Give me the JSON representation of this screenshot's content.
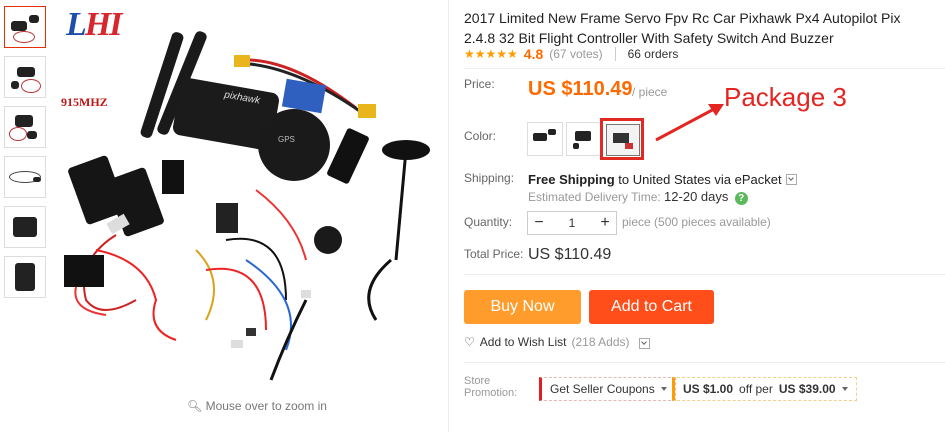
{
  "gallery": {
    "logo_part1": "L",
    "logo_part2": "HI",
    "freq_label": "915MHZ",
    "zoom_hint": "Mouse over to zoom in"
  },
  "product": {
    "title": "2017 Limited New Frame Servo Fpv Rc Car Pixhawk Px4 Autopilot Pix 2.4.8 32 Bit Flight Controller With Safety Switch And Buzzer",
    "rating_stars": "★★★★★",
    "rating_value": "4.8",
    "votes": "(67 votes)",
    "orders": "66 orders"
  },
  "price": {
    "label": "Price:",
    "value": "US $110.49",
    "unit": "/ piece"
  },
  "annotation": {
    "text": "Package 3",
    "color": "#e42521"
  },
  "color": {
    "label": "Color:"
  },
  "shipping": {
    "label": "Shipping:",
    "free_text": "Free Shipping",
    "method_text": "to United States via ePacket",
    "delivery_label": "Estimated Delivery Time:",
    "delivery_days": "12-20 days",
    "help_icon": "?"
  },
  "quantity": {
    "label": "Quantity:",
    "minus": "−",
    "value": "1",
    "plus": "+",
    "info": "piece (500 pieces available)"
  },
  "total": {
    "label": "Total Price:",
    "value": "US $110.49"
  },
  "actions": {
    "buy_now": "Buy Now",
    "add_to_cart": "Add to Cart",
    "wish_list": "Add to Wish List",
    "wish_count": "(218 Adds)"
  },
  "promotion": {
    "label_line1": "Store",
    "label_line2": "Promotion:",
    "coupon_text": "Get Seller Coupons",
    "deal_amount": "US $1.00",
    "deal_mid": "off per",
    "deal_threshold": "US $39.00"
  },
  "colors": {
    "accent": "#ff6a00",
    "buy_now": "#ff9c2b",
    "add_to_cart": "#ff4e1a"
  }
}
